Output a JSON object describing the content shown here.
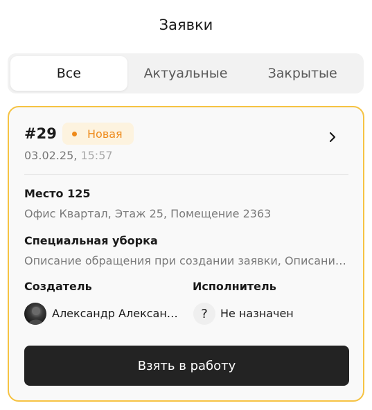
{
  "header": {
    "title": "Заявки"
  },
  "tabs": [
    {
      "label": "Все",
      "active": true
    },
    {
      "label": "Актуальные",
      "active": false
    },
    {
      "label": "Закрытые",
      "active": false
    }
  ],
  "card": {
    "number": "#29",
    "status": {
      "label": "Новая",
      "color": "#ee8a1a",
      "background": "#fdf3df"
    },
    "date": "03.02.25,",
    "time": "15:57",
    "place": {
      "title": "Место 125",
      "address": "Офис Квартал, Этаж 25, Помещение 2363"
    },
    "service": {
      "title": "Специальная уборка",
      "description": "Описание обращения при создании заявки, Описание обращения при создании заявки"
    },
    "creator": {
      "label": "Создатель",
      "name": "Александр Александрович",
      "avatar_icon": "user-photo-avatar"
    },
    "executor": {
      "label": "Исполнитель",
      "name": "Не назначен",
      "icon_glyph": "?"
    },
    "action_label": "Взять в работу",
    "border_color": "#f6c343"
  }
}
